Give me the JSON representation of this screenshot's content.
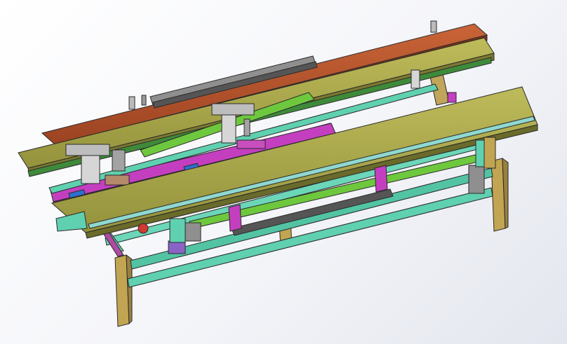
{
  "scene": {
    "subject": "conveyor-assembly-cad-model",
    "background": "#eef0f5",
    "colors": {
      "wood_beam": "#b8a04f",
      "rust_beam": "#b5522c",
      "olive_beam": "#a8a74a",
      "teal_frame": "#5fd0b0",
      "green_rail": "#6ec83e",
      "dark_green": "#3f8a3a",
      "magenta": "#c43fbf",
      "grey_part": "#a9a9a9",
      "dark_grey": "#555555",
      "purple": "#8a63c7",
      "red_part": "#d23a30",
      "outline": "#2a2a2a"
    }
  }
}
